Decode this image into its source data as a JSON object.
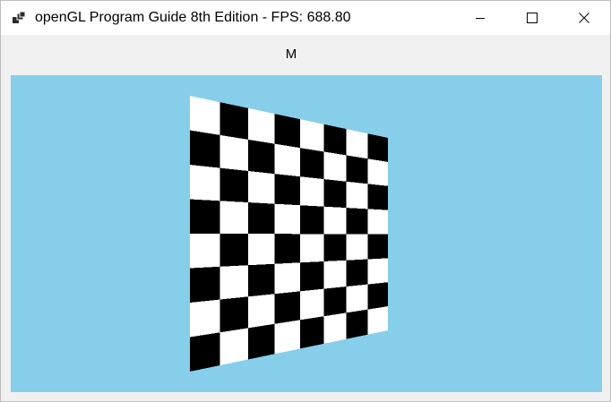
{
  "window": {
    "title": "openGL Program Guide 8th Edition - FPS: 688.80"
  },
  "titlebar_icons": {
    "app": "app-icon",
    "minimize": "minimize-icon",
    "maximize": "maximize-icon",
    "close": "close-icon"
  },
  "menu": {
    "item_label": "M"
  },
  "viewport": {
    "background_color": "#87ceea",
    "content": "checkerboard-quad",
    "grid": {
      "columns": 8,
      "rows": 8
    },
    "colors": {
      "dark": "#000000",
      "light": "#ffffff"
    }
  }
}
